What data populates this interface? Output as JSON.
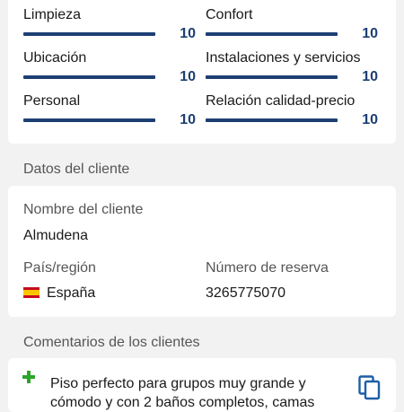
{
  "scores": [
    {
      "label": "Limpieza",
      "value": "10"
    },
    {
      "label": "Confort",
      "value": "10"
    },
    {
      "label": "Ubicación",
      "value": "10"
    },
    {
      "label": "Instalaciones y servicios",
      "value": "10"
    },
    {
      "label": "Personal",
      "value": "10"
    },
    {
      "label": "Relación calidad-precio",
      "value": "10"
    }
  ],
  "client_section": {
    "title": "Datos del cliente",
    "name_label": "Nombre del cliente",
    "name_value": "Almudena",
    "country_label": "País/región",
    "country_value": "España",
    "reservation_label": "Número de reserva",
    "reservation_value": "3265775070"
  },
  "comments_section": {
    "title": "Comentarios de los clientes",
    "comment_text": "Piso perfecto para grupos muy grande y cómodo y con 2 baños completos, camas"
  },
  "colors": {
    "accent": "#1d3f73",
    "positive": "#2aa52a",
    "background": "#f2f2f2"
  },
  "icons": [
    "plus-icon",
    "spain-flag-icon",
    "copy-icon"
  ]
}
